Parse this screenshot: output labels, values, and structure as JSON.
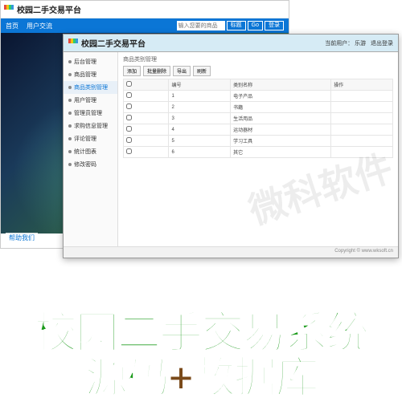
{
  "back": {
    "title": "校园二手交易平台",
    "nav": {
      "home": "首页",
      "user": "用户交流"
    },
    "search": {
      "placeholder": "输入您要的商品",
      "select": "标题",
      "go": "Go",
      "login": "登录"
    },
    "footer": "帮助我们"
  },
  "front": {
    "title": "校园二手交易平台",
    "user_label": "当前用户：",
    "user_name": "乐游",
    "logout": "退出登录",
    "sidebar": [
      {
        "label": "后台管理"
      },
      {
        "label": "商品管理"
      },
      {
        "label": "商品类别管理"
      },
      {
        "label": "用户管理"
      },
      {
        "label": "管理员管理"
      },
      {
        "label": "求购信息管理"
      },
      {
        "label": "评论管理"
      },
      {
        "label": "统计图表"
      },
      {
        "label": "修改密码"
      }
    ],
    "crumb": "商品类别管理",
    "toolbar": {
      "add": "添加",
      "batch_del": "批量删除",
      "export": "导出",
      "refresh": "刷新"
    },
    "table": {
      "headers": [
        "",
        "编号",
        "类别名称",
        "操作"
      ],
      "rows": [
        [
          "1",
          "电子产品",
          ""
        ],
        [
          "2",
          "书籍",
          ""
        ],
        [
          "3",
          "生活用品",
          ""
        ],
        [
          "4",
          "运动器材",
          ""
        ],
        [
          "5",
          "学习工具",
          ""
        ],
        [
          "6",
          "其它",
          ""
        ]
      ]
    },
    "copyright": "Copyright © www.wksoft.cn"
  },
  "watermark": "微科软件",
  "promo": {
    "line1_a": "校园二手交易系统",
    "line2_a": "源码",
    "line2_b": "+",
    "line2_c": "数据库"
  }
}
